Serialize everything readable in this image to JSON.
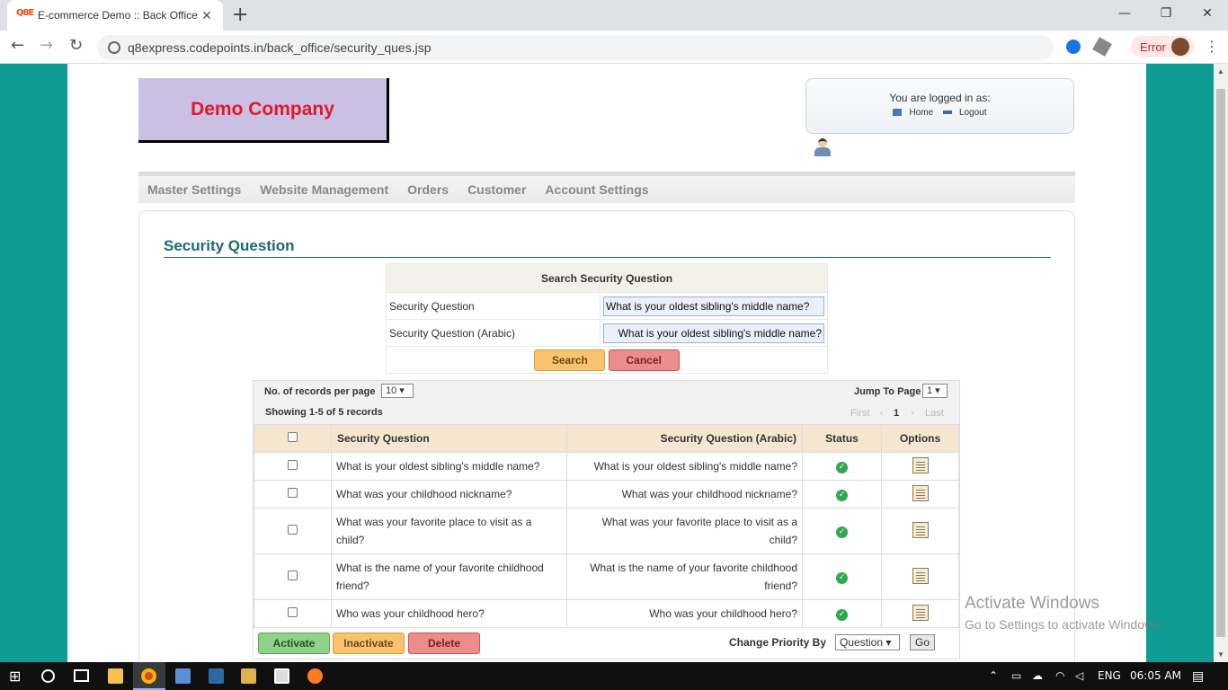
{
  "browser": {
    "tab_title": "E-commerce Demo :: Back Office",
    "favicon_text": "Q8E",
    "url": "q8express.codepoints.in/back_office/security_ques.jsp",
    "error_label": "Error"
  },
  "header": {
    "company_name": "Demo Company",
    "logged_in_label": "You are logged in as:",
    "home_link": "Home",
    "logout_link": "Logout"
  },
  "menu": [
    "Master Settings",
    "Website Management",
    "Orders",
    "Customer",
    "Account Settings"
  ],
  "page_title": "Security Question",
  "search": {
    "heading": "Search Security Question",
    "field1_label": "Security Question",
    "field1_value": "What is your oldest sibling's middle name?",
    "field2_label": "Security Question (Arabic)",
    "field2_value": "What is your oldest sibling's middle name?",
    "search_button": "Search",
    "cancel_button": "Cancel"
  },
  "listing": {
    "per_page_label": "No. of records per page",
    "per_page_value": "10",
    "showing_text": "Showing 1-5 of 5 records",
    "jump_label": "Jump To Page",
    "jump_value": "1",
    "pager": {
      "first": "First",
      "prev": "‹",
      "current": "1",
      "next": "›",
      "last": "Last"
    },
    "columns": [
      "Security Question",
      "Security Question (Arabic)",
      "Status",
      "Options"
    ],
    "rows": [
      {
        "question": "What is your oldest sibling's middle name?",
        "arabic": "What is your oldest sibling's middle name?",
        "status": "active"
      },
      {
        "question": "What was your childhood nickname?",
        "arabic": "What was your childhood nickname?",
        "status": "active"
      },
      {
        "question": "What was your favorite place to visit as a child?",
        "arabic": "What was your favorite place to visit as a child?",
        "status": "active"
      },
      {
        "question": "What is the name of your favorite childhood friend?",
        "arabic": "What is the name of your favorite childhood friend?",
        "status": "active"
      },
      {
        "question": "Who was your childhood hero?",
        "arabic": "Who was your childhood hero?",
        "status": "active"
      }
    ],
    "activate_button": "Activate",
    "inactivate_button": "Inactivate",
    "delete_button": "Delete",
    "priority_label": "Change Priority By",
    "priority_value": "Question",
    "go_button": "Go"
  },
  "watermark": {
    "line1": "Activate Windows",
    "line2": "Go to Settings to activate Windows."
  },
  "taskbar": {
    "language": "ENG",
    "time": "06:05 AM"
  }
}
